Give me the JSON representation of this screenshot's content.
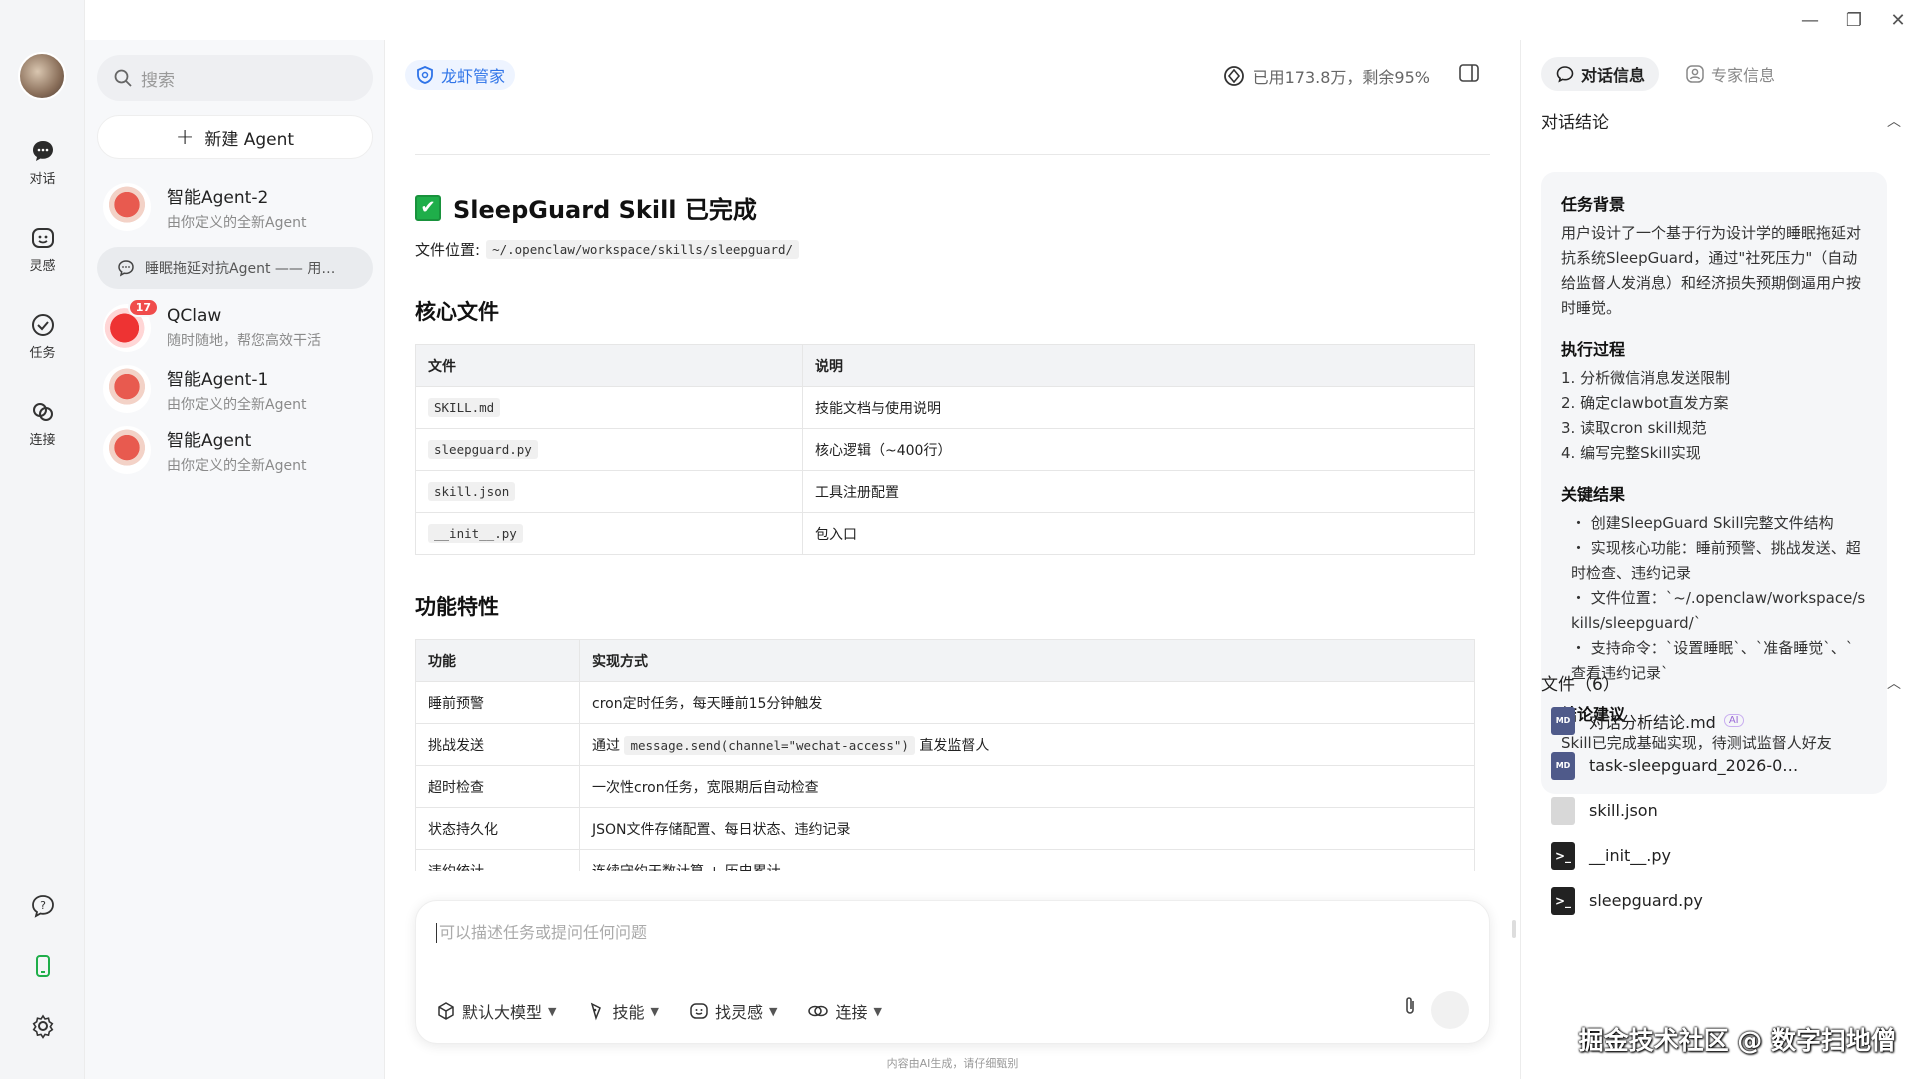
{
  "rail": {
    "items": [
      {
        "label": "对话",
        "icon": "chat-icon"
      },
      {
        "label": "灵感",
        "icon": "inspiration-icon"
      },
      {
        "label": "任务",
        "icon": "task-icon"
      },
      {
        "label": "连接",
        "icon": "link-icon"
      }
    ]
  },
  "sidebar": {
    "search_placeholder": "搜索",
    "new_agent_label": "新建 Agent",
    "agents": [
      {
        "name": "智能Agent-2",
        "desc": "由你定义的全新Agent"
      },
      {
        "name": "QClaw",
        "desc": "随时随地，帮您高效干活",
        "badge": "17"
      },
      {
        "name": "智能Agent-1",
        "desc": "由你定义的全新Agent"
      },
      {
        "name": "智能Agent",
        "desc": "由你定义的全新Agent"
      }
    ],
    "active_chat": "睡眠拖延对抗Agent —— 用…"
  },
  "header": {
    "brand": "龙虾管家",
    "usage": "已用173.8万，剩余95%"
  },
  "content": {
    "title": "SleepGuard Skill 已完成",
    "check_glyph": "✔",
    "file_location_label": "文件位置:",
    "file_location_path": "~/.openclaw/workspace/skills/sleepguard/",
    "section1": "核心文件",
    "table1": {
      "headers": [
        "文件",
        "说明"
      ],
      "rows": [
        [
          "SKILL.md",
          "技能文档与使用说明"
        ],
        [
          "sleepguard.py",
          "核心逻辑（~400行）"
        ],
        [
          "skill.json",
          "工具注册配置"
        ],
        [
          "__init__.py",
          "包入口"
        ]
      ]
    },
    "section2": "功能特性",
    "table2": {
      "headers": [
        "功能",
        "实现方式"
      ],
      "rows": [
        [
          "睡前预警",
          "cron定时任务，每天睡前15分钟触发"
        ],
        [
          "挑战发送",
          "通过",
          "message.send(channel=\"wechat-access\")",
          "直发监督人"
        ],
        [
          "超时检查",
          "一次性cron任务，宽限期后自动检查"
        ],
        [
          "状态持久化",
          "JSON文件存储配置、每日状态、违约记录"
        ],
        [
          "违约统计",
          "连续守约天数计算 + 历史累计"
        ]
      ]
    }
  },
  "composer": {
    "placeholder": "可以描述任务或提问任何问题",
    "tools": [
      "默认大模型",
      "技能",
      "找灵感",
      "连接"
    ],
    "footnote": "内容由AI生成，请仔细甄别"
  },
  "right": {
    "tabs": [
      "对话信息",
      "专家信息"
    ],
    "conclusion_title": "对话结论",
    "summary": {
      "bg_title": "任务背景",
      "bg_text": "用户设计了一个基于行为设计学的睡眠拖延对抗系统SleepGuard，通过\"社死压力\"（自动给监督人发消息）和经济损失预期倒逼用户按时睡觉。",
      "process_title": "执行过程",
      "process": [
        "1. 分析微信消息发送限制",
        "2. 确定clawbot直发方案",
        "3. 读取cron skill规范",
        "4. 编写完整Skill实现"
      ],
      "result_title": "关键结果",
      "results": [
        "・ 创建SleepGuard Skill完整文件结构",
        "・ 实现核心功能：睡前预警、挑战发送、超时检查、违约记录",
        "・ 文件位置：`~/.openclaw/workspace/skills/sleepguard/`",
        "・ 支持命令：`设置睡眠`、`准备睡觉`、`查看违约记录`"
      ],
      "advice_title": "结论建议",
      "advice_text": "Skill已完成基础实现，待测试监督人好友"
    },
    "files_title": "文件（6）",
    "files": [
      {
        "name": "对话分析结论.md",
        "type": "md",
        "ai": "AI"
      },
      {
        "name": "task-sleepguard_2026-0…",
        "type": "md"
      },
      {
        "name": "skill.json",
        "type": "gen"
      },
      {
        "name": "__init__.py",
        "type": "term"
      },
      {
        "name": "sleepguard.py",
        "type": "term"
      }
    ],
    "watermark": "掘金技术社区 @ 数字扫地僧"
  },
  "colors": {
    "accent": "#2f74e8",
    "check": "#1fae4a",
    "badge": "#f04c4c"
  }
}
